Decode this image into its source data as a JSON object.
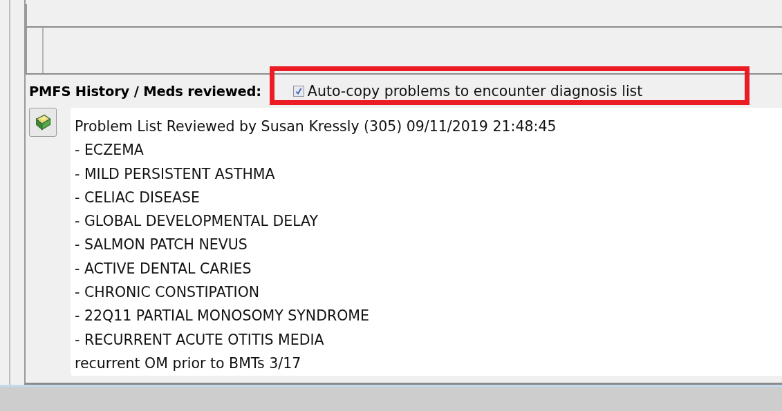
{
  "section": {
    "label": "PMFS History / Meds reviewed:"
  },
  "auto_copy": {
    "label": "Auto-copy problems to encounter diagnosis list",
    "checked": true,
    "highlighted": true
  },
  "notes": {
    "lines": [
      "Problem List Reviewed by Susan Kressly (305) 09/11/2019 21:48:45",
      "- ECZEMA",
      "- MILD PERSISTENT ASTHMA",
      "- CELIAC DISEASE",
      "- GLOBAL DEVELOPMENTAL DELAY",
      "- SALMON PATCH NEVUS",
      "- ACTIVE DENTAL CARIES",
      "- CHRONIC CONSTIPATION",
      "- 22Q11 PARTIAL MONOSOMY SYNDROME",
      "- RECURRENT ACUTE OTITIS MEDIA",
      "recurrent OM prior to BMTs 3/17"
    ]
  }
}
